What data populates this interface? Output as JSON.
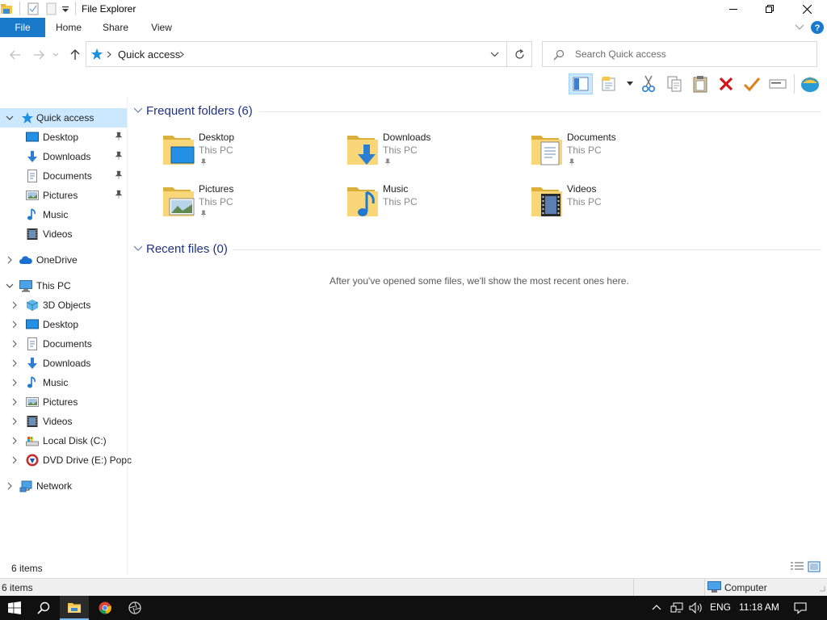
{
  "window": {
    "title": "File Explorer",
    "accent_color": "#1979ca",
    "selected_highlight": "#cce8ff"
  },
  "ribbon": {
    "tabs": [
      "File",
      "Home",
      "Share",
      "View"
    ]
  },
  "address": {
    "location": "Quick access",
    "search_placeholder": "Search Quick access"
  },
  "toolbar": {
    "buttons": [
      "preview-pane",
      "properties",
      "cut",
      "copy",
      "paste",
      "delete",
      "check",
      "rename",
      "web"
    ]
  },
  "navigation": {
    "quick_access": {
      "label": "Quick access",
      "items": [
        {
          "label": "Desktop",
          "icon": "desktop-icon",
          "pinned": true
        },
        {
          "label": "Downloads",
          "icon": "downloads-icon",
          "pinned": true
        },
        {
          "label": "Documents",
          "icon": "documents-icon",
          "pinned": true
        },
        {
          "label": "Pictures",
          "icon": "pictures-icon",
          "pinned": true
        },
        {
          "label": "Music",
          "icon": "music-icon",
          "pinned": false
        },
        {
          "label": "Videos",
          "icon": "videos-icon",
          "pinned": false
        }
      ]
    },
    "onedrive": "OneDrive",
    "this_pc": {
      "label": "This PC",
      "items": [
        {
          "label": "3D Objects",
          "icon": "3d-objects-icon"
        },
        {
          "label": "Desktop",
          "icon": "desktop-icon"
        },
        {
          "label": "Documents",
          "icon": "documents-icon"
        },
        {
          "label": "Downloads",
          "icon": "downloads-icon"
        },
        {
          "label": "Music",
          "icon": "music-icon"
        },
        {
          "label": "Pictures",
          "icon": "pictures-icon"
        },
        {
          "label": "Videos",
          "icon": "videos-icon"
        },
        {
          "label": "Local Disk (C:)",
          "icon": "local-disk-icon"
        },
        {
          "label": "DVD Drive (E:) Popc",
          "icon": "dvd-drive-icon"
        }
      ]
    },
    "network": "Network"
  },
  "content": {
    "frequent_header": "Frequent folders (6)",
    "recent_header": "Recent files (0)",
    "recent_empty": "After you've opened some files, we'll show the most recent ones here.",
    "folders": [
      {
        "name": "Desktop",
        "location": "This PC",
        "pinned": true
      },
      {
        "name": "Downloads",
        "location": "This PC",
        "pinned": true
      },
      {
        "name": "Documents",
        "location": "This PC",
        "pinned": true
      },
      {
        "name": "Pictures",
        "location": "This PC",
        "pinned": true
      },
      {
        "name": "Music",
        "location": "This PC",
        "pinned": false
      },
      {
        "name": "Videos",
        "location": "This PC",
        "pinned": false
      }
    ],
    "item_count": "6 items"
  },
  "statusbar": {
    "count": "6 items",
    "zone": "Computer"
  },
  "taskbar": {
    "language": "ENG",
    "time": "11:18 AM"
  }
}
